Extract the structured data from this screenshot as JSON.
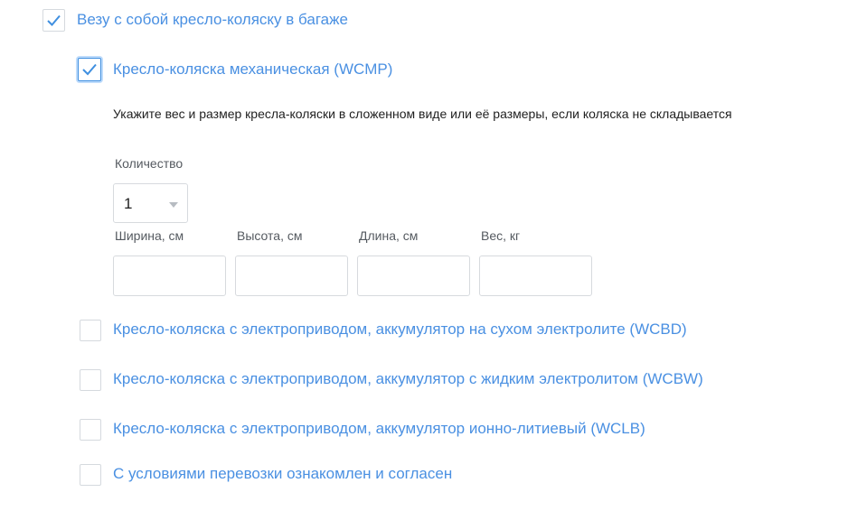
{
  "baggage": {
    "checkbox": {
      "label": "Везу с собой кресло-коляску в багаже",
      "checked": true
    },
    "options": {
      "wcmp": {
        "label": "Кресло-коляска механическая (WCMP)",
        "checked": true
      },
      "wcbd": {
        "label": "Кресло-коляска с электроприводом, аккумулятор на сухом электролите (WCBD)",
        "checked": false
      },
      "wcbw": {
        "label": "Кресло-коляска с электроприводом, аккумулятор с жидким электролитом (WCBW)",
        "checked": false
      },
      "wclb": {
        "label": "Кресло-коляска с электроприводом, аккумулятор ионно-литиевый (WCLB)",
        "checked": false
      }
    },
    "hint": "Укажите вес и размер кресла-коляски в сложенном виде или её размеры, если коляска не складывается",
    "quantity": {
      "label": "Количество",
      "value": "1"
    },
    "dimensions": {
      "width": {
        "label": "Ширина, см",
        "value": ""
      },
      "height": {
        "label": "Высота, см",
        "value": ""
      },
      "length": {
        "label": "Длина, см",
        "value": ""
      },
      "weight": {
        "label": "Вес, кг",
        "value": ""
      }
    },
    "terms": {
      "label": "С условиями перевозки ознакомлен и согласен",
      "checked": false
    }
  },
  "colors": {
    "accent": "#4a90e2",
    "checkmark": "#3f8fe0",
    "border": "#d7dade",
    "text": "#1f1f1f"
  }
}
